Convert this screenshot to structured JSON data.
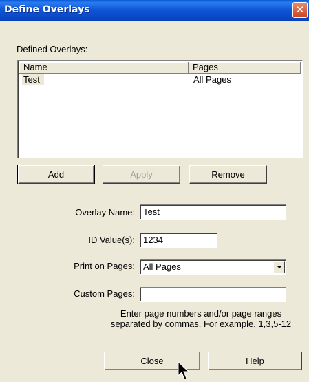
{
  "window": {
    "title": "Define Overlays",
    "close_glyph": "✕"
  },
  "list": {
    "label": "Defined Overlays:",
    "columns": [
      "Name",
      "Pages"
    ],
    "rows": [
      {
        "name": "Test",
        "pages": "All Pages"
      }
    ]
  },
  "buttons": {
    "add": "Add",
    "apply": "Apply",
    "remove": "Remove",
    "close": "Close",
    "help": "Help"
  },
  "form": {
    "overlay_name_label": "Overlay Name:",
    "overlay_name_value": "Test",
    "id_label": "ID Value(s):",
    "id_value": "1234",
    "print_label": "Print on Pages:",
    "print_value": "All Pages",
    "custom_label": "Custom Pages:",
    "custom_value": "",
    "hint_line1": "Enter page numbers and/or page ranges",
    "hint_line2": "separated by commas. For example, 1,3,5-12"
  },
  "icons": {
    "cursor": "mouse-pointer-icon",
    "close": "close-icon",
    "dropdown": "chevron-down-icon"
  },
  "colors": {
    "titlebar": "#0a49c8",
    "dialog_bg": "#ece9d8",
    "close_button": "#c94524"
  }
}
